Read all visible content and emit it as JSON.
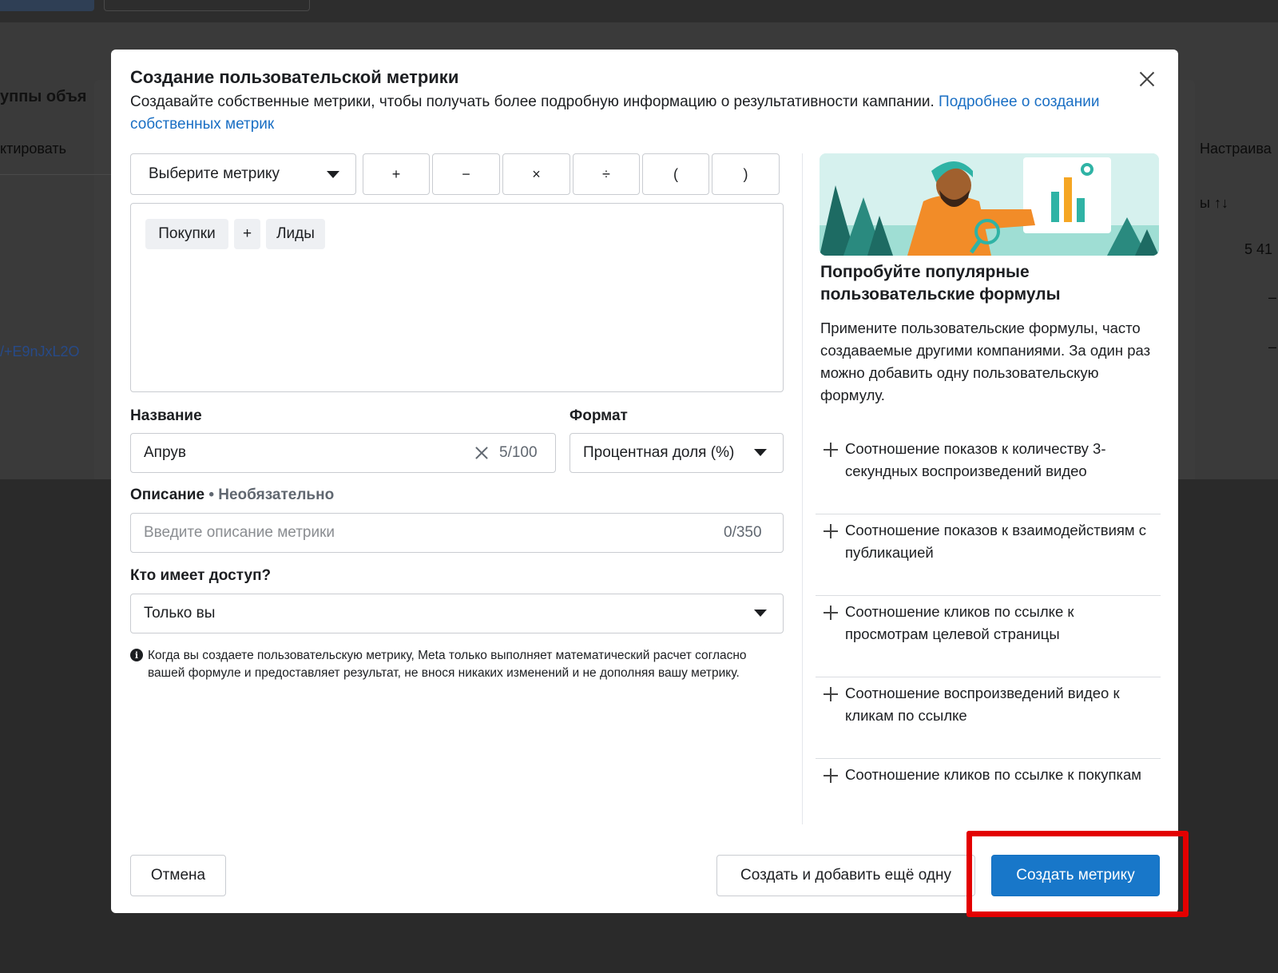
{
  "background": {
    "heading_partial": "уппы объя",
    "action_partial": "ктировать",
    "right_partial": "Настраива",
    "sort_partial": "ы ↑↓",
    "value_partial": "5 41",
    "dash1": "–",
    "dash2": "–",
    "link_partial": "/+E9nJxL2O"
  },
  "modal": {
    "title": "Создание пользовательской метрики",
    "subtitle": "Создавайте собственные метрики, чтобы получать более подробную информацию о результативности кампании. ",
    "subtitle_link": "Подробнее о создании собственных метрик",
    "close_icon": "close-icon"
  },
  "builder": {
    "metric_select_label": "Выберите метрику",
    "operators": [
      "+",
      "−",
      "×",
      "÷",
      "(",
      ")"
    ],
    "formula_chips": [
      "Покупки",
      "+",
      "Лиды"
    ]
  },
  "form": {
    "name_label": "Название",
    "name_value": "Апрув",
    "name_counter": "5/100",
    "format_label": "Формат",
    "format_value": "Процентная доля (%)",
    "description_label": "Описание",
    "description_optional": "Необязательно",
    "description_placeholder": "Введите описание метрики",
    "description_counter": "0/350",
    "access_label": "Кто имеет доступ?",
    "access_value": "Только вы",
    "info_text": "Когда вы создаете пользовательскую метрику, Meta только выполняет математический расчет согласно вашей формуле и предоставляет результат, не внося никаких изменений и не дополняя вашу метрику."
  },
  "suggestions": {
    "title": "Попробуйте популярные пользовательские формулы",
    "description": "Примените пользовательские формулы, часто создаваемые другими компаниями. За один раз можно добавить одну пользовательскую формулу.",
    "items": [
      "Соотношение показов к количеству 3-секундных воспроизведений видео",
      "Соотношение показов к взаимодействиям с публикацией",
      "Соотношение кликов по ссылке к просмотрам целевой страницы",
      "Соотношение воспроизведений видео к кликам по ссылке",
      "Соотношение кликов по ссылке к покупкам"
    ]
  },
  "footer": {
    "cancel_label": "Отмена",
    "create_and_add_label": "Создать и добавить ещё одну",
    "create_label": "Создать метрику"
  },
  "colors": {
    "primary": "#1877c9",
    "link": "#1a6fc4",
    "highlight": "#e30000"
  }
}
